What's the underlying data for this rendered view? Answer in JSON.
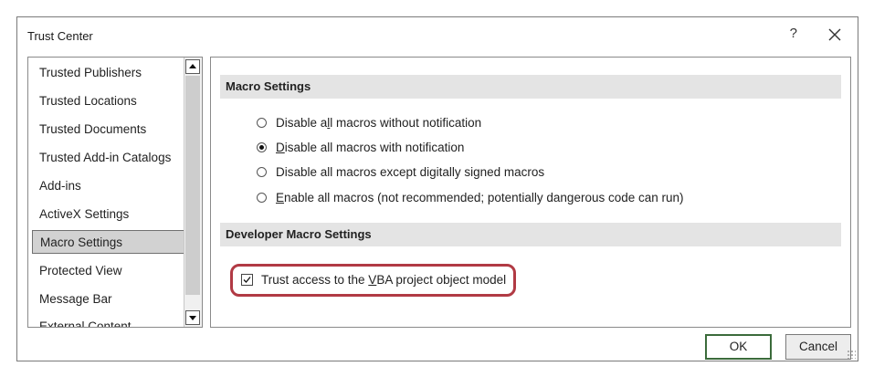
{
  "dialog": {
    "title": "Trust Center",
    "help_label": "?",
    "close_icon": "close-icon"
  },
  "sidebar": {
    "items": [
      {
        "label": "Trusted Publishers",
        "selected": false
      },
      {
        "label": "Trusted Locations",
        "selected": false
      },
      {
        "label": "Trusted Documents",
        "selected": false
      },
      {
        "label": "Trusted Add-in Catalogs",
        "selected": false
      },
      {
        "label": "Add-ins",
        "selected": false
      },
      {
        "label": "ActiveX Settings",
        "selected": false
      },
      {
        "label": "Macro Settings",
        "selected": true
      },
      {
        "label": "Protected View",
        "selected": false
      },
      {
        "label": "Message Bar",
        "selected": false
      },
      {
        "label": "External Content",
        "selected": false
      }
    ]
  },
  "macro_settings": {
    "header": "Macro Settings",
    "options": [
      {
        "pre": "Disable a",
        "u": "l",
        "post": "l macros without notification",
        "checked": false
      },
      {
        "pre": "",
        "u": "D",
        "post": "isable all macros with notification",
        "checked": true
      },
      {
        "pre": "Disable all macros except di",
        "u": "g",
        "post": "itally signed macros",
        "checked": false
      },
      {
        "pre": "",
        "u": "E",
        "post": "nable all macros (not recommended; potentially dangerous code can run)",
        "checked": false
      }
    ]
  },
  "developer_settings": {
    "header": "Developer Macro Settings",
    "trust_vba": {
      "pre": "Trust access to the ",
      "u": "V",
      "post": "BA project object model",
      "checked": true
    }
  },
  "buttons": {
    "ok": "OK",
    "cancel": "Cancel"
  },
  "colors": {
    "highlight_border": "#b13a44",
    "ok_border": "#3b6b3b"
  }
}
